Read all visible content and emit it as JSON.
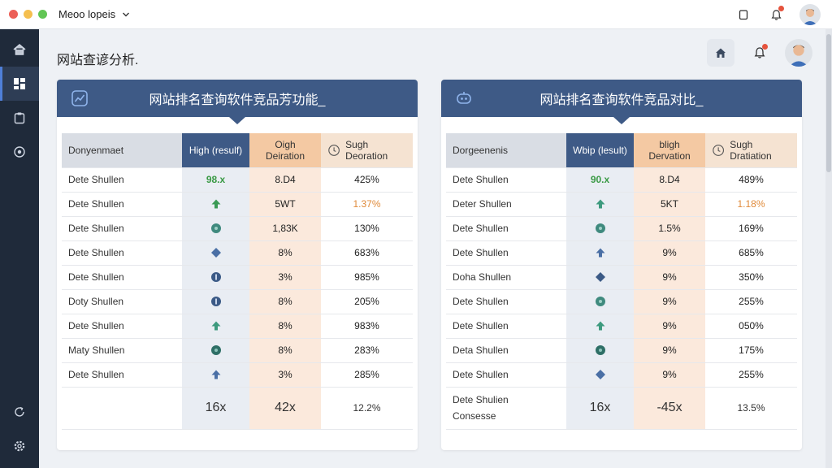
{
  "app": {
    "title": "Meoo lopeis",
    "colors": {
      "close": "#ec5f57",
      "minimize": "#f5bf4f",
      "maximize": "#61c554",
      "accent": "#3e5a86",
      "sidebar": "#1f2a3a"
    },
    "titlebar_icons": [
      "copy-icon",
      "bell-icon",
      "avatar"
    ]
  },
  "sidebar": {
    "items": [
      {
        "icon": "home-icon",
        "active": false
      },
      {
        "icon": "dashboard-icon",
        "active": true
      },
      {
        "icon": "clipboard-icon",
        "active": false
      },
      {
        "icon": "gear-badge-icon",
        "active": false
      }
    ],
    "bottom": [
      {
        "icon": "refresh-icon"
      },
      {
        "icon": "settings-icon"
      }
    ]
  },
  "header": {
    "page_title": "网站查谚分析.",
    "actions": [
      "home-icon",
      "bell-icon",
      "avatar"
    ]
  },
  "panels": [
    {
      "title": "网站排名查询软件竞品芳功能_",
      "icon": "chart-icon",
      "columns": {
        "name": "Donyenmaet",
        "high": "High (resulf)",
        "orig": "Oigh Deiration",
        "sugh": "Sugh Deoration"
      },
      "rows": [
        {
          "name": "Dete Shullen",
          "high": "98.x",
          "high_type": "text-green",
          "orig": "8.D4",
          "sugh": "425%",
          "sugh_color": "normal"
        },
        {
          "name": "Dete Shullen",
          "high": "",
          "high_type": "arrow-up-green",
          "orig": "5WT",
          "sugh": "1.37%",
          "sugh_color": "orange"
        },
        {
          "name": "Dete Shullen",
          "high": "",
          "high_type": "dot-teal",
          "orig": "1,83K",
          "sugh": "130%",
          "sugh_color": "normal"
        },
        {
          "name": "Dete Shullen",
          "high": "",
          "high_type": "diamond-blue",
          "orig": "8%",
          "sugh": "683%",
          "sugh_color": "normal"
        },
        {
          "name": "Dete Shullen",
          "high": "",
          "high_type": "dot-navy",
          "orig": "3%",
          "sugh": "985%",
          "sugh_color": "normal"
        },
        {
          "name": "Doty Shullen",
          "high": "",
          "high_type": "dot-navy",
          "orig": "8%",
          "sugh": "205%",
          "sugh_color": "normal"
        },
        {
          "name": "Dete Shullen",
          "high": "",
          "high_type": "arrow-up-teal",
          "orig": "8%",
          "sugh": "983%",
          "sugh_color": "normal"
        },
        {
          "name": "Maty Shullen",
          "high": "",
          "high_type": "dot-dark-teal",
          "orig": "8%",
          "sugh": "283%",
          "sugh_color": "normal"
        },
        {
          "name": "Dete Shullen",
          "high": "",
          "high_type": "arrow-up-blue",
          "orig": "3%",
          "sugh": "285%",
          "sugh_color": "normal"
        }
      ],
      "total": {
        "name_line1": "",
        "name_line2": "",
        "high": "16x",
        "orig": "42x",
        "sugh": "12.2%"
      }
    },
    {
      "title": "网站排名查询软件竞品对比_",
      "icon": "robot-icon",
      "columns": {
        "name": "Dorgeenenis",
        "high": "Wbip (lesult)",
        "orig": "bligh Dervation",
        "sugh": "Sugh Dratiation"
      },
      "rows": [
        {
          "name": "Dete Shullen",
          "high": "90.x",
          "high_type": "text-green",
          "orig": "8.D4",
          "sugh": "489%",
          "sugh_color": "normal"
        },
        {
          "name": "Deter Shullen",
          "high": "",
          "high_type": "arrow-up-teal",
          "orig": "5KT",
          "sugh": "1.18%",
          "sugh_color": "orange"
        },
        {
          "name": "Dete Shullen",
          "high": "",
          "high_type": "dot-teal",
          "orig": "1.5%",
          "sugh": "169%",
          "sugh_color": "normal"
        },
        {
          "name": "Dete Shullen",
          "high": "",
          "high_type": "arrow-up-blue",
          "orig": "9%",
          "sugh": "685%",
          "sugh_color": "normal"
        },
        {
          "name": "Doha Shullen",
          "high": "",
          "high_type": "diamond-navy",
          "orig": "9%",
          "sugh": "350%",
          "sugh_color": "normal"
        },
        {
          "name": "Dete Shullen",
          "high": "",
          "high_type": "dot-teal",
          "orig": "9%",
          "sugh": "255%",
          "sugh_color": "normal"
        },
        {
          "name": "Dete Shullen",
          "high": "",
          "high_type": "arrow-up-teal",
          "orig": "9%",
          "sugh": "050%",
          "sugh_color": "normal"
        },
        {
          "name": "Deta Shullen",
          "high": "",
          "high_type": "dot-dark-teal",
          "orig": "9%",
          "sugh": "175%",
          "sugh_color": "normal"
        },
        {
          "name": "Dete Shullen",
          "high": "",
          "high_type": "diamond-blue",
          "orig": "9%",
          "sugh": "255%",
          "sugh_color": "normal"
        }
      ],
      "total": {
        "name_line1": "Dete Shulien",
        "name_line2": "Consesse",
        "high": "16x",
        "orig": "-45x",
        "sugh": "13.5%"
      }
    }
  ]
}
